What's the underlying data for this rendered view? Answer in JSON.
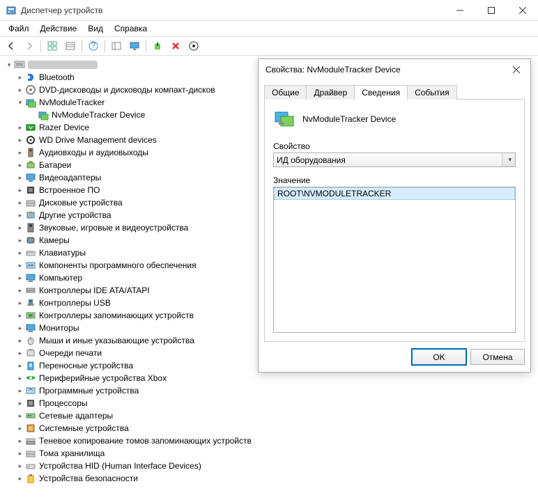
{
  "window": {
    "title": "Диспетчер устройств"
  },
  "menu": {
    "file": "Файл",
    "action": "Действие",
    "view": "Вид",
    "help": "Справка"
  },
  "tree": {
    "root": "",
    "items": [
      "Bluetooth",
      "DVD-дисководы и дисководы компакт-дисков",
      "NvModuleTracker",
      "Razer Device",
      "WD Drive Management devices",
      "Аудиовходы и аудиовыходы",
      "Батареи",
      "Видеоадаптеры",
      "Встроенное ПО",
      "Дисковые устройства",
      "Другие устройства",
      "Звуковые, игровые и видеоустройства",
      "Камеры",
      "Клавиатуры",
      "Компоненты программного обеспечения",
      "Компьютер",
      "Контроллеры IDE ATA/ATAPI",
      "Контроллеры USB",
      "Контроллеры запоминающих устройств",
      "Мониторы",
      "Мыши и иные указывающие устройства",
      "Очереди печати",
      "Переносные устройства",
      "Периферийные устройства Xbox",
      "Программные устройства",
      "Процессоры",
      "Сетевые адаптеры",
      "Системные устройства",
      "Теневое копирование томов запоминающих устройств",
      "Тома хранилища",
      "Устройства HID (Human Interface Devices)",
      "Устройства безопасности"
    ],
    "child": "NvModuleTracker Device"
  },
  "dialog": {
    "title": "Свойства: NvModuleTracker Device",
    "tabs": {
      "general": "Общие",
      "driver": "Драйвер",
      "details": "Сведения",
      "events": "События"
    },
    "device": "NvModuleTracker Device",
    "property_label": "Свойство",
    "property_value": "ИД оборудования",
    "value_label": "Значение",
    "value": "ROOT\\NVMODULETRACKER",
    "ok": "OK",
    "cancel": "Отмена"
  }
}
